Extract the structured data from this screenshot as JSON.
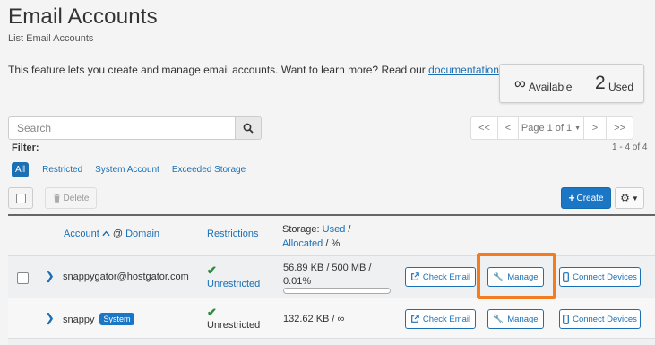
{
  "page": {
    "title": "Email Accounts",
    "subtitle": "List Email Accounts",
    "description": "This feature lets you create and manage email accounts. Want to learn more? Read our",
    "doc_link": "documentation",
    "desc_end": "."
  },
  "stats": {
    "available_symbol": "∞",
    "available_label": "Available",
    "used_count": "2",
    "used_label": "Used"
  },
  "search": {
    "placeholder": "Search"
  },
  "pagination": {
    "first": "<<",
    "prev": "<",
    "page_label": "Page 1 of 1",
    "next": ">",
    "last": ">>",
    "count": "1 - 4 of 4"
  },
  "filter": {
    "label": "Filter:",
    "options": [
      "All",
      "Restricted",
      "System Account",
      "Exceeded Storage"
    ],
    "selected": "All"
  },
  "toolbar": {
    "delete_label": "Delete",
    "create_label": "Create"
  },
  "table": {
    "headers": {
      "account": "Account",
      "at": "@",
      "domain": "Domain",
      "restrictions": "Restrictions",
      "storage_label": "Storage:",
      "storage_used": "Used",
      "storage_slash": "/",
      "storage_allocated": "Allocated",
      "storage_percent": "/ %"
    },
    "rows": [
      {
        "account": "snappygator@hostgator.com",
        "badge": "",
        "restriction": "Unrestricted",
        "storage_line1": "56.89 KB / 500 MB /",
        "storage_line2": "0.01%",
        "usage_percent": 0.01,
        "actions": [
          "Check Email",
          "Manage",
          "Connect Devices"
        ]
      },
      {
        "account": "snappy",
        "badge": "System",
        "restriction": "Unrestricted",
        "storage_line1": "132.62 KB / ∞",
        "storage_line2": "",
        "actions": [
          "Check Email",
          "Manage",
          "Connect Devices"
        ]
      }
    ]
  },
  "colors": {
    "accent": "#1b6fb5",
    "highlight": "#f47c20",
    "success": "#2b8a3e"
  }
}
